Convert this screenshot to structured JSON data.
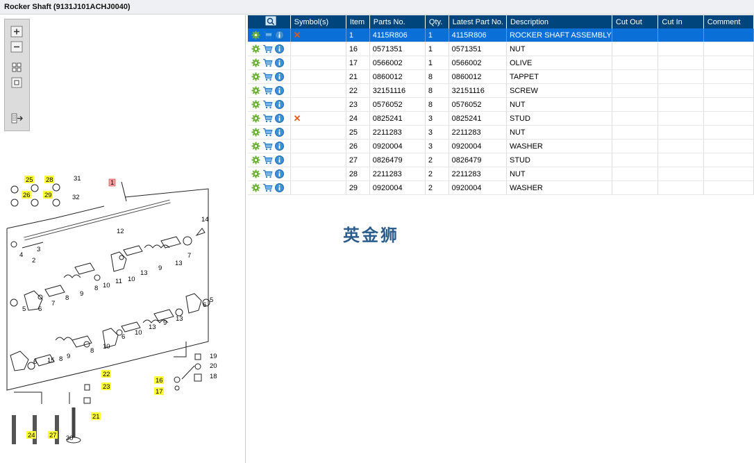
{
  "window": {
    "title": "Rocker Shaft (9131J101ACHJ0040)"
  },
  "toolbar": {
    "buttons": [
      {
        "name": "zoom-in-icon"
      },
      {
        "name": "zoom-out-icon"
      },
      {
        "name": "fit-all-icon"
      },
      {
        "name": "actual-size-icon"
      },
      {
        "name": "export-icon"
      }
    ]
  },
  "diagram": {
    "highlighted_callouts": [
      "25",
      "28",
      "26",
      "29",
      "22",
      "23",
      "16",
      "17",
      "21",
      "24",
      "27"
    ],
    "selected_callout": "1",
    "callouts": [
      "31",
      "32",
      "1",
      "12",
      "14",
      "4",
      "3",
      "2",
      "7",
      "9",
      "13",
      "11",
      "10",
      "8",
      "5",
      "6",
      "15",
      "19",
      "20",
      "18",
      "30"
    ]
  },
  "table": {
    "columns": [
      "",
      "Symbol(s)",
      "Item",
      "Parts No.",
      "Qty.",
      "Latest Part No.",
      "Description",
      "Cut Out",
      "Cut In",
      "Comment"
    ],
    "rows": [
      {
        "symbol": "x",
        "item": "1",
        "part": "4115R806",
        "qty": "1",
        "latest": "4115R806",
        "desc": "ROCKER SHAFT ASSEMBLY",
        "selected": true
      },
      {
        "symbol": "",
        "item": "16",
        "part": "0571351",
        "qty": "1",
        "latest": "0571351",
        "desc": "NUT"
      },
      {
        "symbol": "",
        "item": "17",
        "part": "0566002",
        "qty": "1",
        "latest": "0566002",
        "desc": "OLIVE"
      },
      {
        "symbol": "",
        "item": "21",
        "part": "0860012",
        "qty": "8",
        "latest": "0860012",
        "desc": "TAPPET"
      },
      {
        "symbol": "",
        "item": "22",
        "part": "32151116",
        "qty": "8",
        "latest": "32151116",
        "desc": "SCREW"
      },
      {
        "symbol": "",
        "item": "23",
        "part": "0576052",
        "qty": "8",
        "latest": "0576052",
        "desc": "NUT"
      },
      {
        "symbol": "x",
        "item": "24",
        "part": "0825241",
        "qty": "3",
        "latest": "0825241",
        "desc": "STUD"
      },
      {
        "symbol": "",
        "item": "25",
        "part": "2211283",
        "qty": "3",
        "latest": "2211283",
        "desc": "NUT"
      },
      {
        "symbol": "",
        "item": "26",
        "part": "0920004",
        "qty": "3",
        "latest": "0920004",
        "desc": "WASHER"
      },
      {
        "symbol": "",
        "item": "27",
        "part": "0826479",
        "qty": "2",
        "latest": "0826479",
        "desc": "STUD"
      },
      {
        "symbol": "",
        "item": "28",
        "part": "2211283",
        "qty": "2",
        "latest": "2211283",
        "desc": "NUT"
      },
      {
        "symbol": "",
        "item": "29",
        "part": "0920004",
        "qty": "2",
        "latest": "0920004",
        "desc": "WASHER"
      }
    ]
  },
  "row_icons": [
    "gear-icon",
    "cart-icon",
    "info-icon"
  ],
  "watermark": "英金狮",
  "colors": {
    "header": "#00457c",
    "selected": "#0a6fd7",
    "highlight": "#ffff33",
    "xmark": "#e05a1a"
  }
}
